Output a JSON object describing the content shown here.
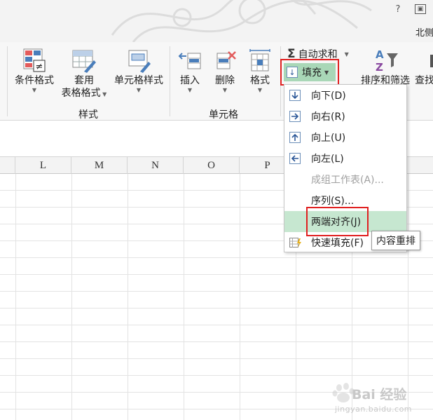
{
  "window": {
    "help_label": "?",
    "restore_label": "▣",
    "user_name": "北侧"
  },
  "ribbon": {
    "styles_group": {
      "label": "样式",
      "conditional_format": "条件格式",
      "table_format_line1": "套用",
      "table_format_line2": "表格格式",
      "cell_styles": "单元格样式"
    },
    "cells_group": {
      "label": "单元格",
      "insert": "插入",
      "delete": "删除",
      "format": "格式"
    },
    "editing_group": {
      "autosum": "自动求和",
      "fill": "填充",
      "sort_filter": "排序和筛选",
      "find": "查找"
    }
  },
  "fill_menu": {
    "items": [
      {
        "label": "向下(D)",
        "enabled": true
      },
      {
        "label": "向右(R)",
        "enabled": true
      },
      {
        "label": "向上(U)",
        "enabled": true
      },
      {
        "label": "向左(L)",
        "enabled": true
      },
      {
        "label": "成组工作表(A)...",
        "enabled": false
      },
      {
        "label": "序列(S)...",
        "enabled": true
      },
      {
        "label": "两端对齐(J)",
        "enabled": true,
        "hovered": true
      },
      {
        "label": "快速填充(F)",
        "enabled": true
      }
    ],
    "tooltip": "内容重排"
  },
  "grid": {
    "columns": [
      "L",
      "M",
      "N",
      "O",
      "P"
    ]
  },
  "watermark": {
    "brand": "Bai 经验",
    "url": "jingyan.baidu.com"
  },
  "colors": {
    "accent_green": "#a9d7b7",
    "hover_green": "#c6e7d0",
    "highlight_red": "#e02020"
  }
}
